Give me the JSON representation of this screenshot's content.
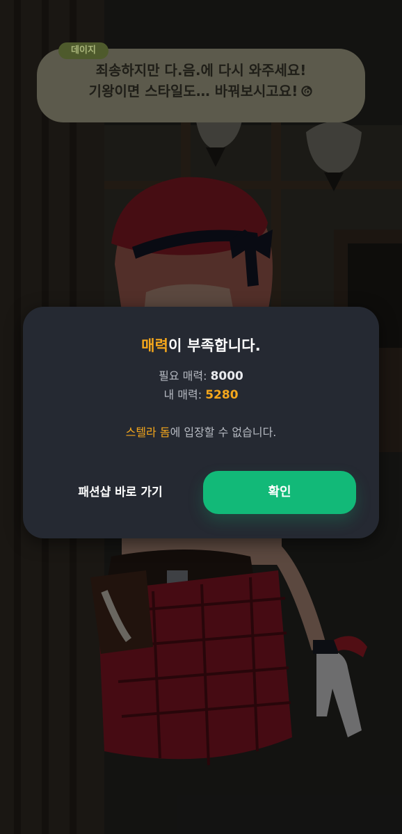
{
  "speech": {
    "speaker": "데이지",
    "line1": "죄송하지만 다.음.에 다시 와주세요!",
    "line2": "기왕이면 스타일도… 바꿔보시고요!",
    "trailing_icon": "swirl-icon"
  },
  "dialog": {
    "title_accent": "매력",
    "title_rest": "이 부족합니다.",
    "required_label": "필요 매력: ",
    "required_value": "8000",
    "mine_label": "내 매력: ",
    "mine_value": "5280",
    "notice_accent": "스텔라 돔",
    "notice_rest": "에 입장할 수 없습니다.",
    "shop_button": "패션샵 바로 가기",
    "confirm_button": "확인"
  },
  "colors": {
    "accent": "#f5a71c",
    "confirm": "#12b978",
    "dialog_bg": "#252932"
  }
}
